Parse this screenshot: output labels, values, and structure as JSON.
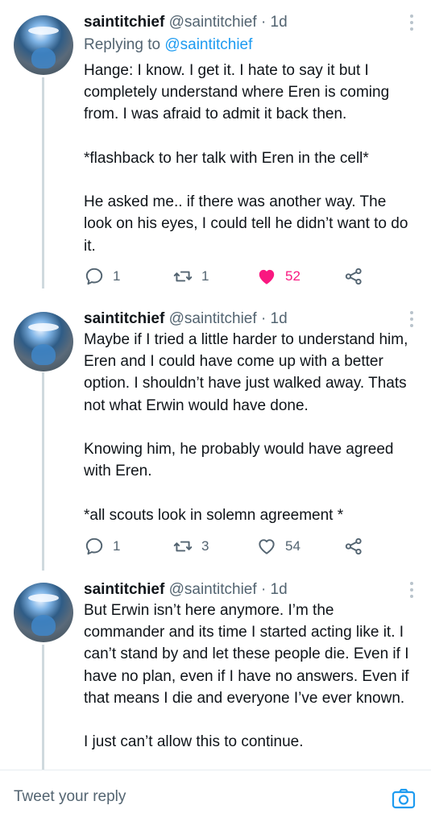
{
  "tweets": [
    {
      "name": "saintitchief",
      "handle": "@saintitchief",
      "dot": "·",
      "time": "1d",
      "replying_prefix": "Replying to",
      "replying_to": "@saintitchief",
      "paragraphs": [
        "Hange: I know. I get it. I hate to say it but I completely understand where Eren is coming from. I was afraid to admit it back then.",
        "*flashback to her talk with Eren in the cell*",
        "He asked me.. if there was another way. The look on his eyes, I could tell he didn’t want to do it."
      ],
      "replies": "1",
      "retweets": "1",
      "likes": "52",
      "liked": true
    },
    {
      "name": "saintitchief",
      "handle": "@saintitchief",
      "dot": "·",
      "time": "1d",
      "paragraphs": [
        "Maybe if I tried a little harder to understand him, Eren and I could have come up with a better option. I shouldn’t have just walked away. Thats not what Erwin would have done.",
        "Knowing him, he probably would have agreed with Eren.",
        "*all scouts look in solemn agreement *"
      ],
      "replies": "1",
      "retweets": "3",
      "likes": "54",
      "liked": false
    },
    {
      "name": "saintitchief",
      "handle": "@saintitchief",
      "dot": "·",
      "time": "1d",
      "paragraphs": [
        "But Erwin isn’t here anymore. I’m the commander and its time I started acting like it. I can’t stand by and let these people die. Even if I have no plan, even if I have no answers. Even if that means I die and everyone I’ve ever known.",
        "I just can’t allow this to continue."
      ]
    }
  ],
  "reply_bar": {
    "placeholder": "Tweet your reply"
  },
  "icons": {
    "reply": "reply-icon",
    "retweet": "retweet-icon",
    "like": "heart-icon",
    "share": "share-icon",
    "more": "more-icon",
    "camera": "camera-icon"
  },
  "colors": {
    "accent": "#1d9bf0",
    "like": "#f91880",
    "muted": "#536471"
  }
}
